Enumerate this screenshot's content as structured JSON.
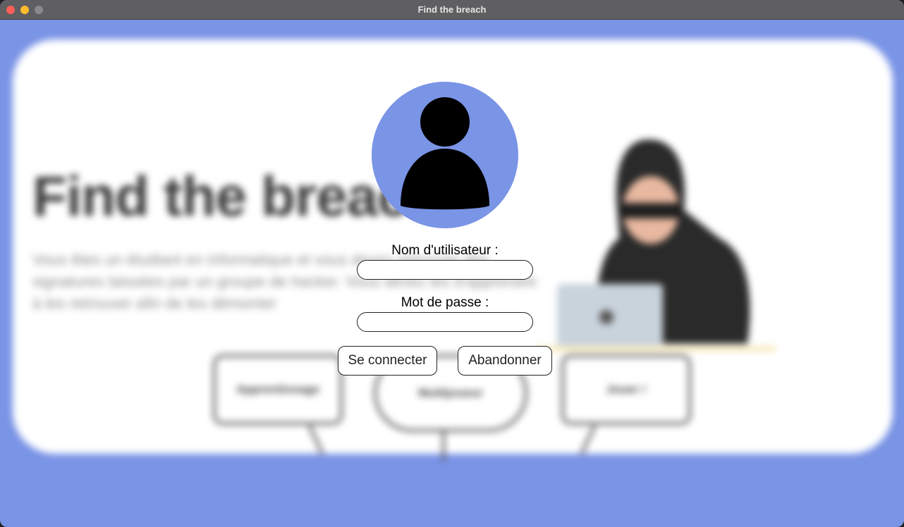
{
  "window": {
    "title": "Find the breach"
  },
  "background": {
    "heading": "Find the breach",
    "paragraph": "Vous êtes un étudiant en informatique et vous devez retrouver des signatures laissées par un groupe de hacker. Vous devez les d'apprendre à les retrouver afin de les démonter",
    "bubbles": [
      "Apprentissage",
      "Multijoueur",
      "Jouer !"
    ]
  },
  "login": {
    "avatar_icon": "user-icon",
    "username_label": "Nom d'utilisateur :",
    "username_value": "",
    "password_label": "Mot de passe :",
    "password_value": "",
    "login_button": "Se connecter",
    "abandon_button": "Abandonner"
  },
  "colors": {
    "accent": "#7a94e6",
    "titlebar": "#5f5f61",
    "card": "#ffffff"
  }
}
